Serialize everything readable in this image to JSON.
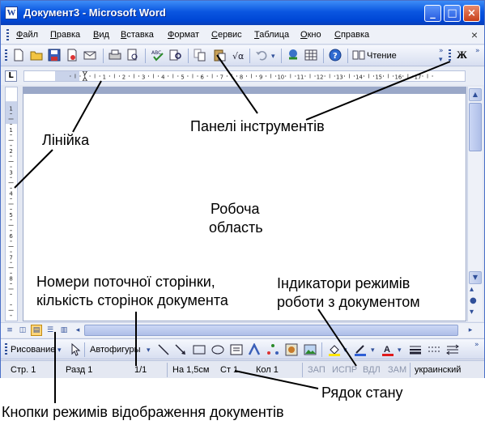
{
  "window": {
    "title": "Документ3 - Microsoft Word",
    "title_icon": "W",
    "controls": [
      "_",
      "□",
      "×"
    ],
    "doc_close": "×"
  },
  "menu": [
    "Файл",
    "Правка",
    "Вид",
    "Вставка",
    "Формат",
    "Сервис",
    "Таблица",
    "Окно",
    "Справка"
  ],
  "toolbar": {
    "icons": [
      "new-doc-icon",
      "open-folder-icon",
      "save-icon",
      "permission-icon",
      "email-icon",
      "print-icon",
      "print-preview-icon",
      "spelling-icon",
      "research-icon",
      "copy-icon",
      "paste-icon",
      "format-painter-icon",
      "undo-icon",
      "hyperlink-icon",
      "tables-icon",
      "help-icon",
      "read-icon"
    ],
    "read_label": "Чтение",
    "bold_label": "Ж"
  },
  "ruler": {
    "corner": "L",
    "h_numbers": [
      "1",
      "1",
      "2",
      "3",
      "4",
      "5",
      "6",
      "7",
      "8",
      "9",
      "10",
      "11",
      "12",
      "13",
      "14",
      "15",
      "16",
      "17"
    ],
    "v_numbers": [
      "1",
      "1",
      "2",
      "3",
      "4",
      "5",
      "6",
      "7",
      "8"
    ]
  },
  "view_buttons": [
    "normal-view",
    "web-layout-view",
    "print-layout-view",
    "outline-view",
    "reading-view"
  ],
  "drawing": {
    "draw_label": "Рисование",
    "autoshapes_label": "Автофигуры",
    "font_color_letter": "A"
  },
  "status": {
    "page": "Стр. 1",
    "section": "Разд 1",
    "pages": "1/1",
    "at": "На 1,5см",
    "line": "Ст 1",
    "col": "Кол 1",
    "rec": "ЗАП",
    "trk": "ИСПР",
    "ext": "ВДЛ",
    "ovr": "ЗАМ",
    "lang": "украинский"
  },
  "annotations": {
    "ruler": "Лінійка",
    "toolbars": "Панелі інструментів",
    "workspace_1": "Робоча",
    "workspace_2": "область",
    "page_numbers_1": "Номери поточної сторінки,",
    "page_numbers_2": "кількість сторінок документа",
    "mode_indicators_1": "Індикатори режимів",
    "mode_indicators_2": "роботи з документом",
    "status_bar": "Рядок стану",
    "view_buttons": "Кнопки режимів відображення документів"
  },
  "colors": {
    "title_bar": "#0a56e0",
    "toolbar_bg": "#d7def0",
    "close_button": "#c8401a",
    "annotation_line": "#000000"
  }
}
